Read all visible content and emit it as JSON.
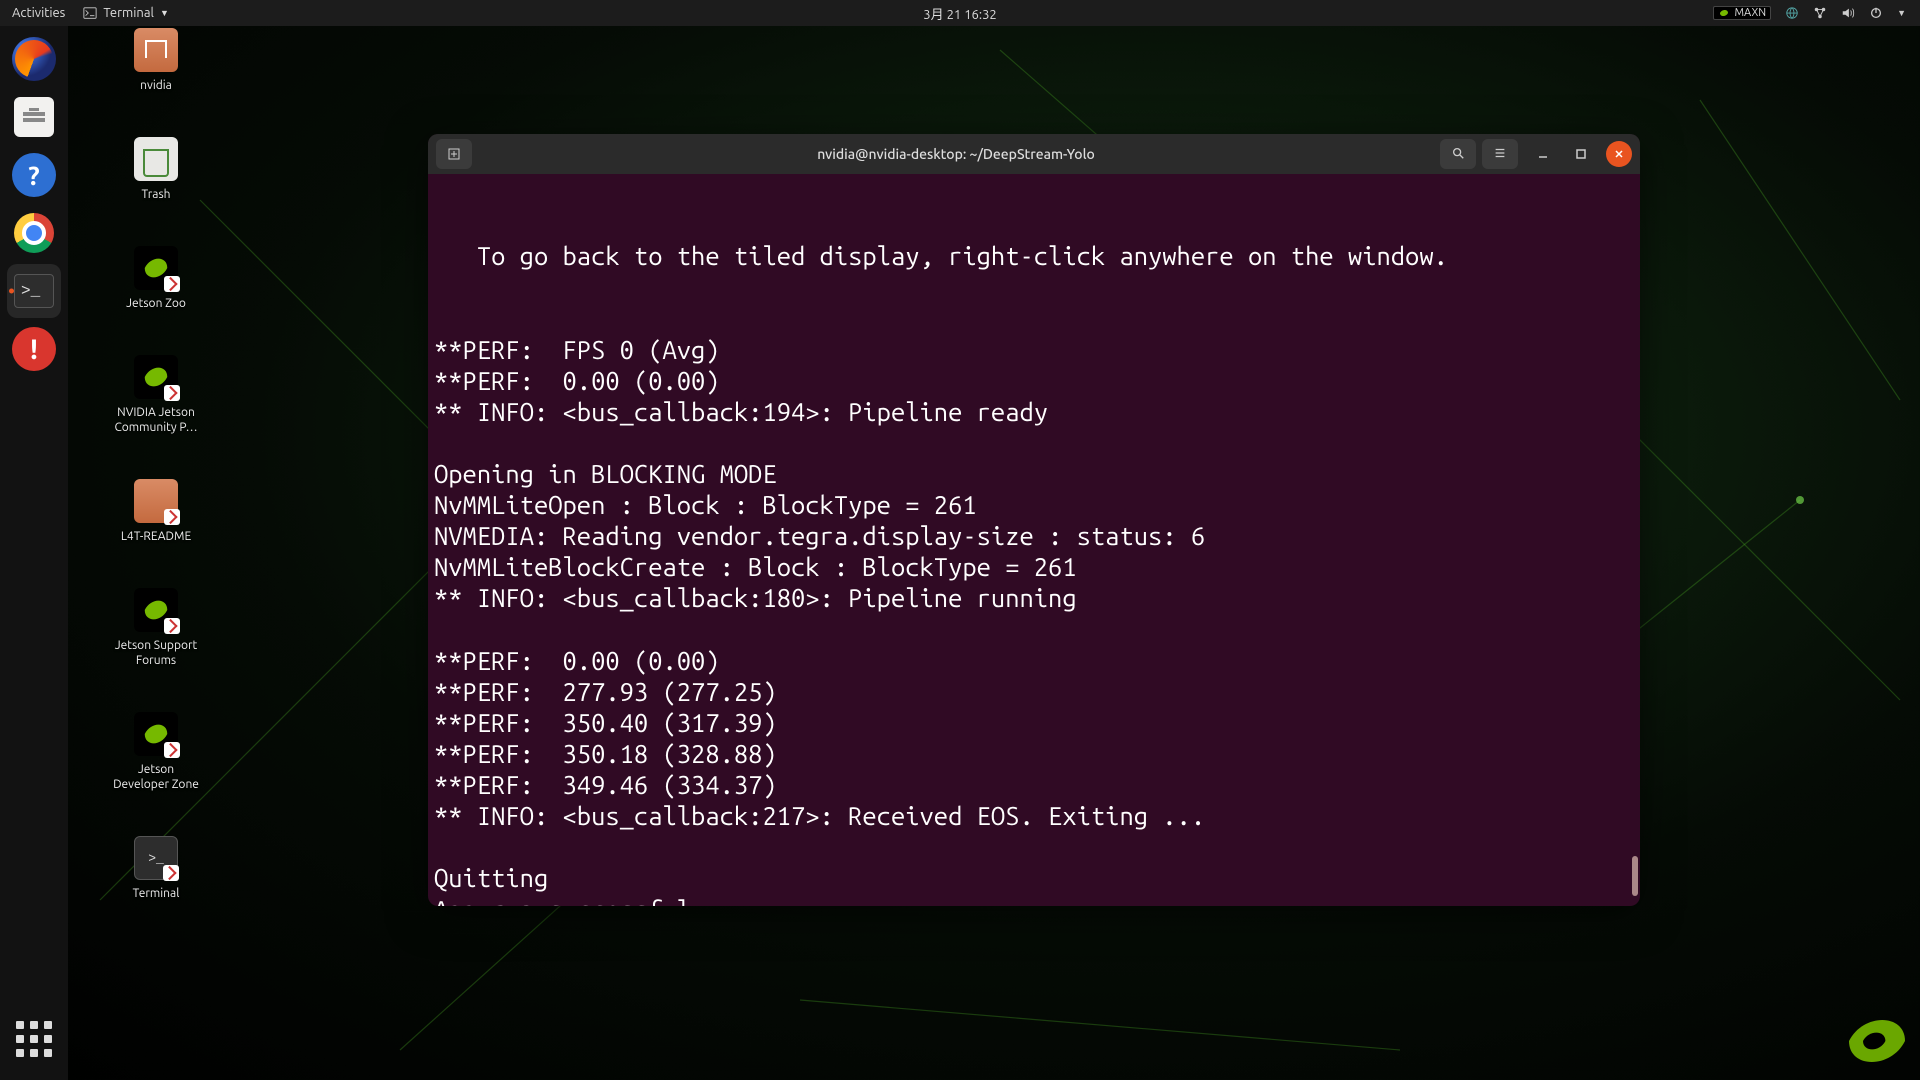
{
  "topbar": {
    "activities": "Activities",
    "app_name": "Terminal",
    "clock": "3月 21  16:32",
    "power_mode": "MAXN"
  },
  "dock": {
    "items": [
      {
        "name": "firefox",
        "interactable": true
      },
      {
        "name": "files",
        "interactable": true
      },
      {
        "name": "help",
        "interactable": true
      },
      {
        "name": "chromium",
        "interactable": true
      },
      {
        "name": "terminal",
        "interactable": true,
        "active": true
      },
      {
        "name": "apport",
        "interactable": true
      }
    ]
  },
  "desktop": {
    "icons": [
      {
        "label": "nvidia",
        "type": "folder-home"
      },
      {
        "label": "Trash",
        "type": "trash"
      },
      {
        "label": "Jetson Zoo",
        "type": "nvlogo-link"
      },
      {
        "label": "NVIDIA Jetson\nCommunity P…",
        "type": "nvlogo-link"
      },
      {
        "label": "L4T-README",
        "type": "folder-link"
      },
      {
        "label": "Jetson Support\nForums",
        "type": "nvlogo-link"
      },
      {
        "label": "Jetson\nDeveloper Zone",
        "type": "nvlogo-link"
      },
      {
        "label": "Terminal",
        "type": "terminal-link"
      }
    ]
  },
  "terminal": {
    "title": "nvidia@nvidia-desktop: ~/DeepStream-Yolo",
    "lines": [
      "   To go back to the tiled display, right-click anywhere on the window.",
      "",
      "",
      "**PERF:  FPS 0 (Avg)",
      "**PERF:  0.00 (0.00)",
      "** INFO: <bus_callback:194>: Pipeline ready",
      "",
      "Opening in BLOCKING MODE",
      "NvMMLiteOpen : Block : BlockType = 261",
      "NVMEDIA: Reading vendor.tegra.display-size : status: 6",
      "NvMMLiteBlockCreate : Block : BlockType = 261",
      "** INFO: <bus_callback:180>: Pipeline running",
      "",
      "**PERF:  0.00 (0.00)",
      "**PERF:  277.93 (277.25)",
      "**PERF:  350.40 (317.39)",
      "**PERF:  350.18 (328.88)",
      "**PERF:  349.46 (334.37)",
      "** INFO: <bus_callback:217>: Received EOS. Exiting ...",
      "",
      "Quitting",
      "App run successful"
    ],
    "prompt": {
      "user": "nvidia@nvidia-desktop",
      "sep": ":",
      "path": "~/DeepStream-Yolo",
      "end": "$ "
    }
  },
  "colors": {
    "terminal_bg": "#300a24",
    "prompt_user": "#87d13c",
    "prompt_path": "#5aa8d6",
    "close_btn": "#e95420"
  }
}
